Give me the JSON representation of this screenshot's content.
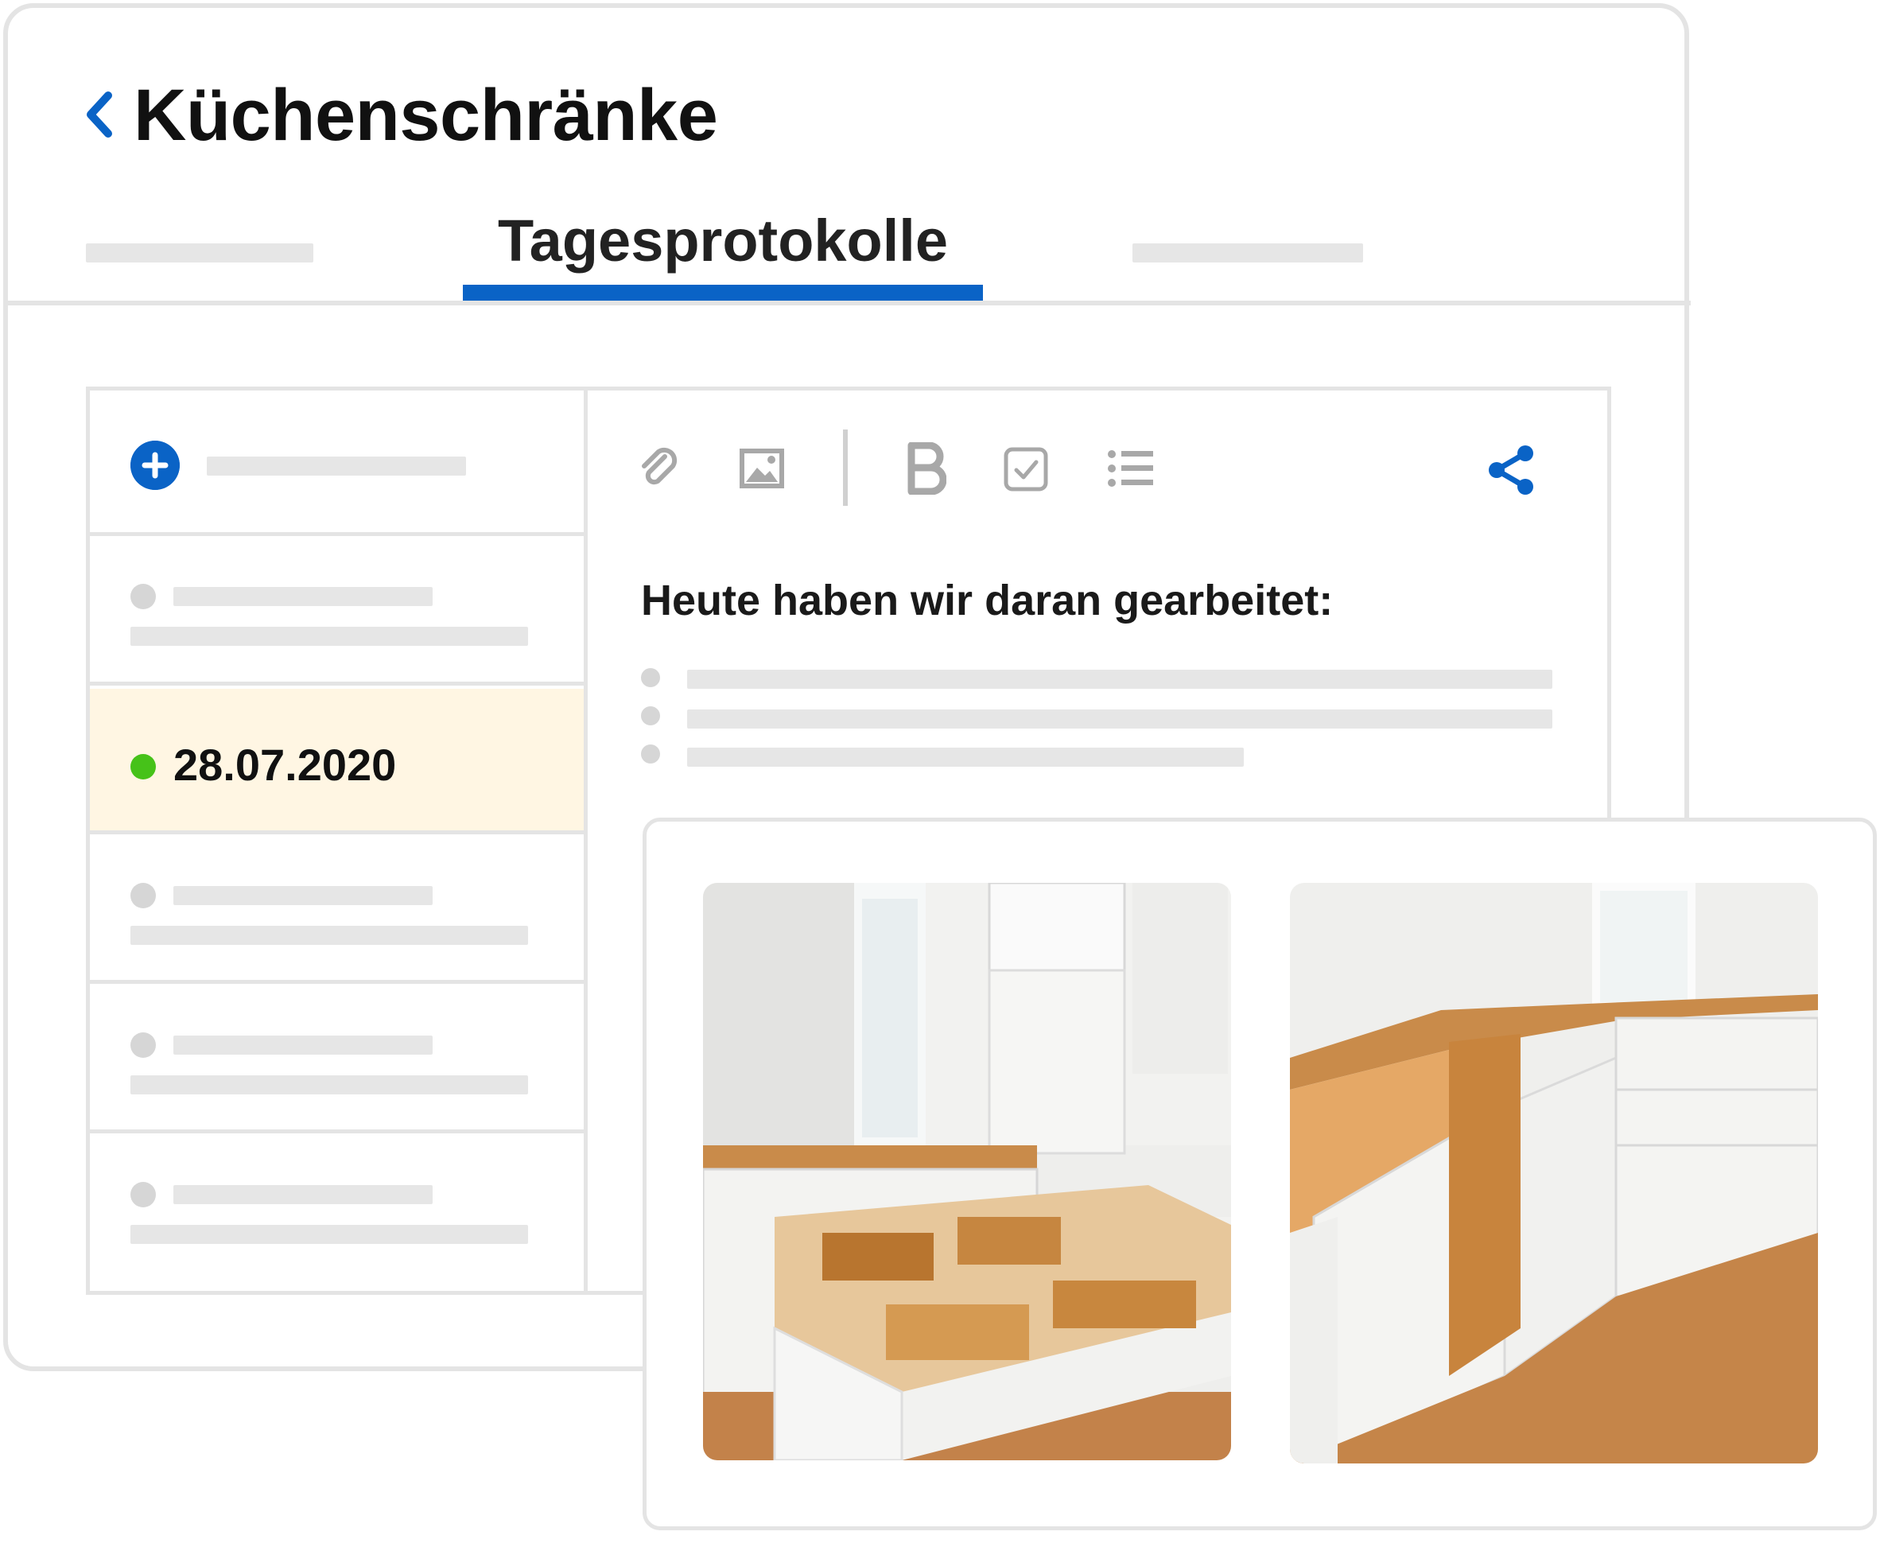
{
  "header": {
    "back_icon": "chevron-left-icon",
    "title": "Küchenschränke"
  },
  "tabs": {
    "active_label": "Tagesprotokolle"
  },
  "log_list": {
    "add_icon": "plus-circle-icon",
    "selected_entry": {
      "date": "28.07.2020",
      "status_color": "#46c219"
    }
  },
  "toolbar": {
    "icons": [
      "paperclip-icon",
      "image-icon",
      "bold-icon",
      "checkbox-icon",
      "list-icon",
      "share-icon"
    ]
  },
  "editor": {
    "heading": "Heute haben wir daran gearbeitet:"
  },
  "photos": {
    "items": [
      "kitchen-photo-1",
      "kitchen-photo-2"
    ]
  },
  "colors": {
    "accent": "#0a63c6",
    "selected_row": "#fff6e3",
    "placeholder": "#e6e6e6",
    "border": "#e4e4e4"
  }
}
